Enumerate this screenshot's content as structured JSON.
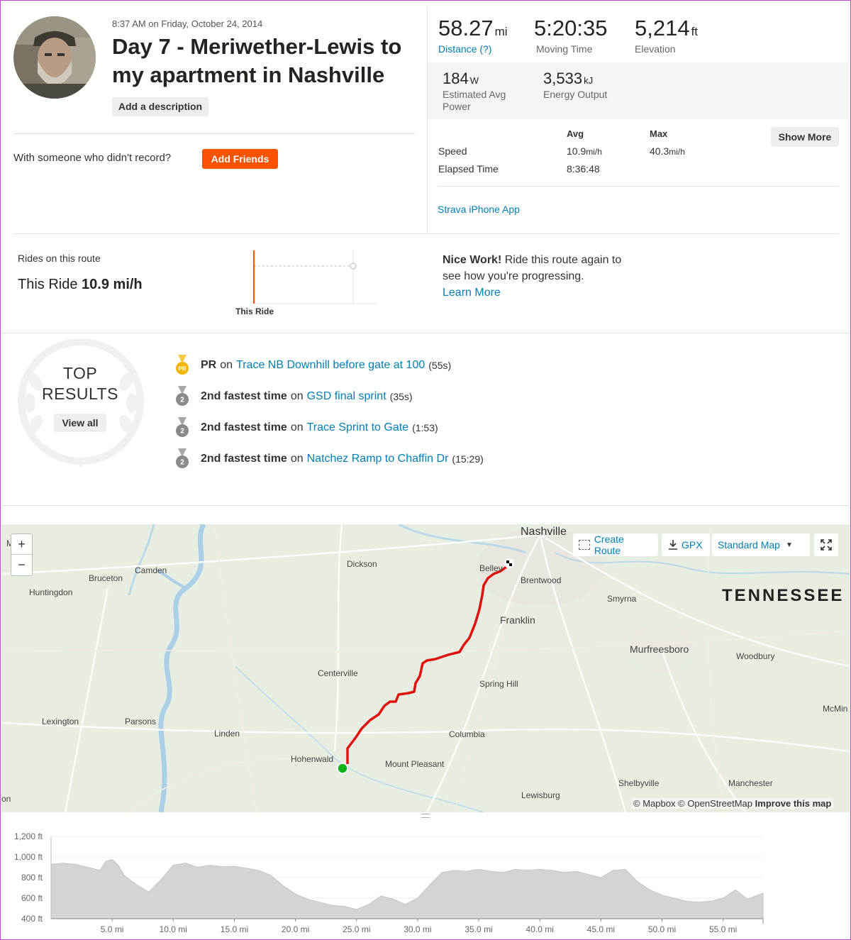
{
  "activity": {
    "date": "8:37 AM on Friday, October 24, 2014",
    "title": "Day 7 - Meriwether-Lewis to my apartment in Nashville",
    "add_description": "Add a description",
    "with_someone": "With someone who didn't record?",
    "add_friends": "Add Friends"
  },
  "stats": {
    "distance": {
      "value": "58.27",
      "unit": "mi",
      "label": "Distance (?)"
    },
    "moving_time": {
      "value": "5:20:35",
      "label": "Moving Time"
    },
    "elevation": {
      "value": "5,214",
      "unit": "ft",
      "label": "Elevation"
    },
    "power": {
      "value": "184",
      "unit": "W",
      "label": "Estimated Avg Power"
    },
    "energy": {
      "value": "3,533",
      "unit": "kJ",
      "label": "Energy Output"
    },
    "table": {
      "avg_header": "Avg",
      "max_header": "Max",
      "rows": [
        {
          "label": "Speed",
          "avg": "10.9",
          "avg_unit": "mi/h",
          "max": "40.3",
          "max_unit": "mi/h"
        },
        {
          "label": "Elapsed Time",
          "avg": "8:36:48",
          "avg_unit": "",
          "max": "",
          "max_unit": ""
        }
      ]
    },
    "show_more": "Show More",
    "device": "Strava iPhone App"
  },
  "route": {
    "title": "Rides on this route",
    "this_ride_prefix": "This Ride",
    "this_ride_speed": "10.9 mi/h",
    "chart_label": "This Ride",
    "nice_work_bold": "Nice Work!",
    "nice_work_text": " Ride this route again to see how you're progressing.",
    "learn_more": "Learn More"
  },
  "top_results": {
    "heading_line1": "TOP",
    "heading_line2": "RESULTS",
    "view_all": "View all",
    "items": [
      {
        "badge": "PR",
        "rank": "PR",
        "on": "on",
        "segment": "Trace NB Downhill before gate at 100",
        "time": "(55s)",
        "color": "#f2b600"
      },
      {
        "badge": "2",
        "rank": "2nd fastest time",
        "on": "on",
        "segment": "GSD final sprint",
        "time": "(35s)",
        "color": "#8a8a8e"
      },
      {
        "badge": "2",
        "rank": "2nd fastest time",
        "on": "on",
        "segment": "Trace Sprint to Gate",
        "time": "(1:53)",
        "color": "#8a8a8e"
      },
      {
        "badge": "2",
        "rank": "2nd fastest time",
        "on": "on",
        "segment": "Natchez Ramp to Chaffin Dr",
        "time": "(15:29)",
        "color": "#8a8a8e"
      }
    ]
  },
  "map": {
    "zoom_in": "+",
    "zoom_out": "−",
    "create_route": "Create Route",
    "gpx": "GPX",
    "map_style": "Standard Map",
    "state_label": "TENNESSEE",
    "attribution_1": "© Mapbox © OpenStreetMap",
    "attribution_2": "Improve this map",
    "cities": {
      "nashville": "Nashville",
      "mckenzie": "M   zie",
      "camden": "Camden",
      "bruceton": "Bruceton",
      "huntingdon": "Huntingdon",
      "dickson": "Dickson",
      "bellevue": "Bellev",
      "brentwood": "Brentwood",
      "smyrna": "Smyrna",
      "franklin": "Franklin",
      "murfreesboro": "Murfreesboro",
      "woodbury": "Woodbury",
      "centerville": "Centerville",
      "spring_hill": "Spring Hill",
      "mcminnville": "McMin",
      "lexington": "Lexington",
      "parsons": "Parsons",
      "linden": "Linden",
      "columbia": "Columbia",
      "hohenwald": "Hohenwald",
      "mount_pleasant": "Mount Pleasant",
      "shelbyville": "Shelbyville",
      "manchester": "Manchester",
      "lewisburg": "Lewisburg",
      "edge": "on"
    },
    "route_color": "#e0120e",
    "start_color": "#12b317"
  },
  "chart_data": {
    "type": "area",
    "title": "",
    "xlabel": "",
    "ylabel": "",
    "x_ticks": [
      "5.0 mi",
      "10.0 mi",
      "15.0 mi",
      "20.0 mi",
      "25.0 mi",
      "30.0 mi",
      "35.0 mi",
      "40.0 mi",
      "45.0 mi",
      "50.0 mi",
      "55.0 mi"
    ],
    "y_ticks": [
      "1,200 ft",
      "1,000 ft",
      "800 ft",
      "600 ft",
      "400 ft"
    ],
    "xlim": [
      0,
      58.27
    ],
    "ylim": [
      400,
      1200
    ],
    "series": [
      {
        "x": [
          0,
          1,
          2,
          3,
          4,
          4.5,
          5,
          5.5,
          6,
          7,
          8,
          9,
          10,
          11,
          12,
          13,
          14,
          15,
          16,
          17,
          18,
          19,
          20,
          21,
          22,
          23,
          24,
          25,
          26,
          27,
          28,
          29,
          30,
          31,
          32,
          33,
          34,
          35,
          36,
          37,
          38,
          39,
          40,
          41,
          42,
          43,
          44,
          45,
          46,
          47,
          48,
          49,
          50,
          51,
          52,
          53,
          54,
          55,
          56,
          57,
          58.27
        ],
        "y": [
          930,
          940,
          930,
          900,
          870,
          960,
          975,
          920,
          820,
          730,
          660,
          780,
          920,
          940,
          900,
          920,
          905,
          910,
          890,
          870,
          820,
          720,
          640,
          590,
          560,
          530,
          520,
          490,
          540,
          620,
          590,
          540,
          600,
          730,
          850,
          870,
          860,
          880,
          860,
          850,
          880,
          870,
          880,
          870,
          850,
          860,
          830,
          800,
          870,
          880,
          760,
          680,
          630,
          600,
          570,
          560,
          570,
          600,
          680,
          590,
          650
        ],
        "color": "#d4d4d7"
      }
    ]
  }
}
